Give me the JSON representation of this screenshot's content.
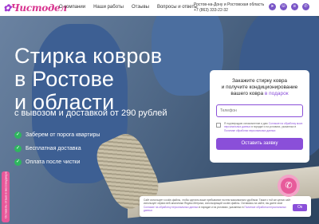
{
  "brand": {
    "logo_text": "Чистодел"
  },
  "nav": [
    "О компании",
    "Наши работы",
    "Отзывы",
    "Вопросы и ответы"
  ],
  "header": {
    "region": "Ростов-на-Дону и Ростовская область",
    "phone": "+7 (863) 333-22-32"
  },
  "social": [
    "telegram-icon",
    "viber-icon",
    "vk-icon",
    "whatsapp-icon"
  ],
  "hero": {
    "headline_1": "Стирка ковров",
    "headline_2": "в Ростове",
    "headline_3": "и области",
    "subhead": "с вывозом и доставкой от 290 рублей",
    "bullets": [
      "Заберем от порога квартиры",
      "Бесплатная доставка",
      "Оплата после чистки"
    ]
  },
  "form": {
    "title_1": "Закажите стирку ковра",
    "title_2": "и получите кондиционирование",
    "title_3": "вашего ковра",
    "title_accent": "в подарок",
    "phone_placeholder": "Телефон",
    "consent_pre": "Я подтверждаю ознакомление и даю",
    "consent_link_1": "Согласие на обработку моих персональных данных",
    "consent_mid": "в порядке и на условиях, указанных в",
    "consent_link_2": "Политике обработки персональных данных",
    "submit_label": "Оставить заявку"
  },
  "side_tab": {
    "label": "Оставить отзыв в мессенджере"
  },
  "cookie": {
    "text_1": "Сайт использует cookie-файлы, чтобы сделать ваше пребывание на нем максимально удобным. Также с той же целью сайт использует сервис веб-аналитики Яндекс.Метрика, использующий cookie-файлы. Оставаясь на сайте, вы даете свое",
    "link_1": "Согласие на обработку персональных данных",
    "text_2": "в порядке и на условиях, указанных в",
    "link_2": "Политике обработки персональных данных",
    "ok_label": "Ок"
  },
  "colors": {
    "accent": "#8a4fd9",
    "brand": "#d8348f",
    "check": "#2fb65f",
    "call": "#e75b9b"
  }
}
